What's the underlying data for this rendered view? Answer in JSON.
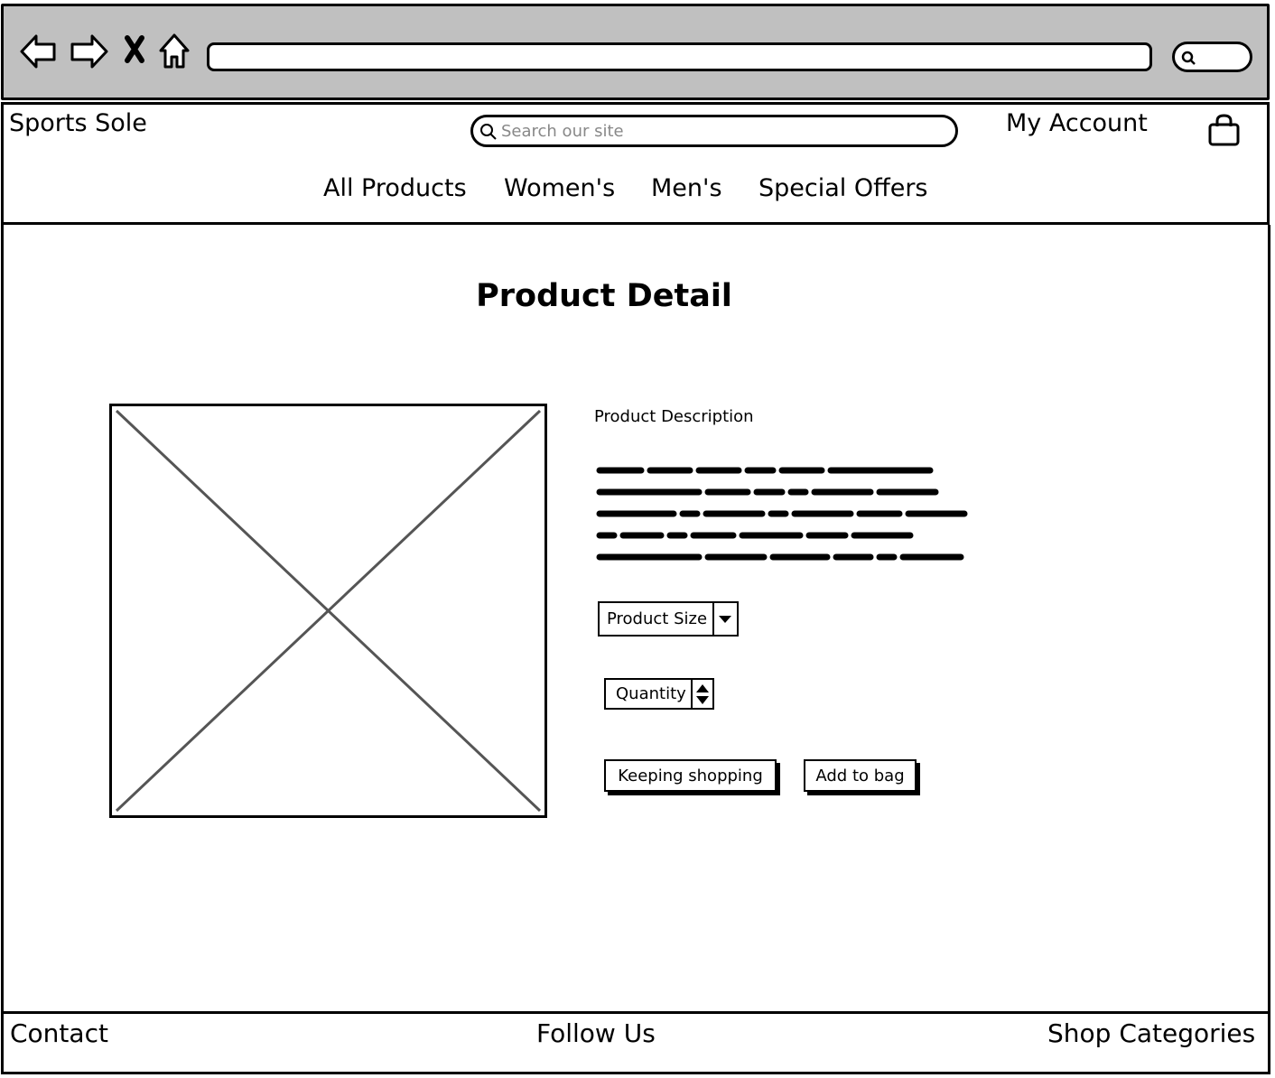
{
  "browser": {
    "icons": [
      "back-arrow-icon",
      "forward-arrow-icon",
      "close-icon",
      "home-icon",
      "search-icon"
    ]
  },
  "header": {
    "brand": "Sports Sole",
    "search_placeholder": "Search our site",
    "account_label": "My Account",
    "nav": [
      "All Products",
      "Women's",
      "Men's",
      "Special Offers"
    ]
  },
  "main": {
    "title": "Product Detail",
    "description_label": "Product Description",
    "size_select": {
      "value": "Product Size"
    },
    "quantity_stepper": {
      "label": "Quantity"
    },
    "buttons": {
      "keep_shopping": "Keeping shopping",
      "add_to_bag": "Add to bag"
    }
  },
  "footer": {
    "contact": "Contact",
    "follow": "Follow Us",
    "categories": "Shop Categories"
  }
}
